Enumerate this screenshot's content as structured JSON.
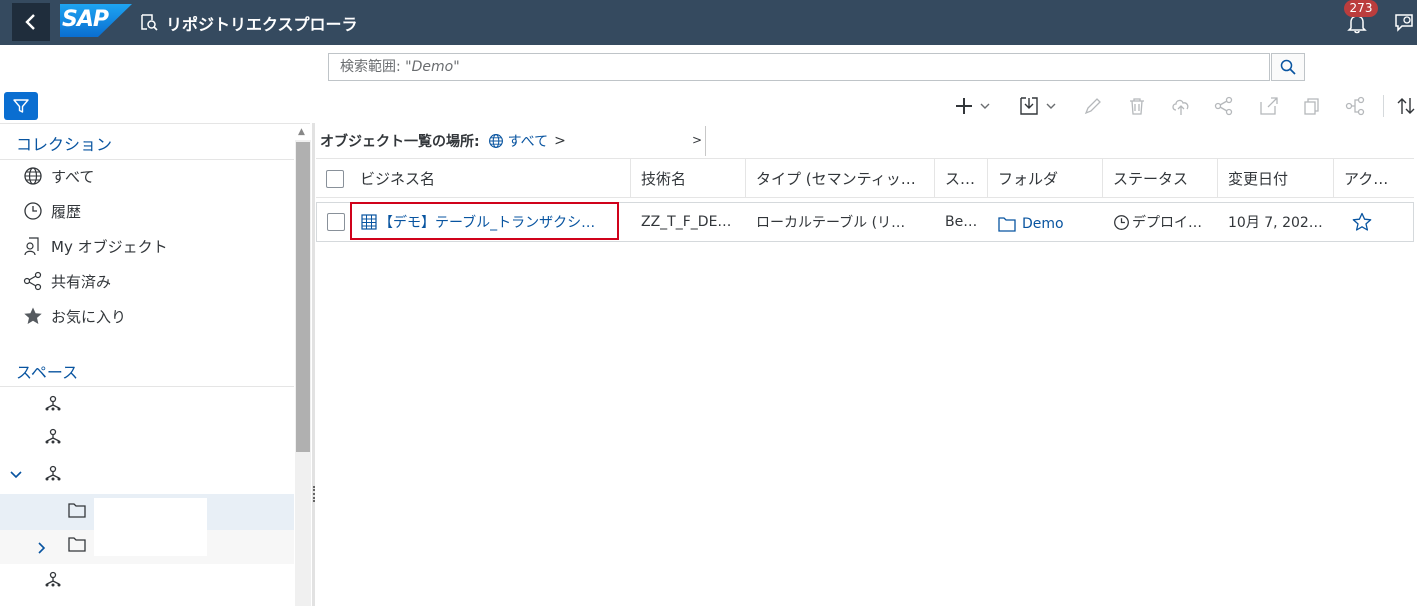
{
  "shell": {
    "logo_text": "SAP",
    "app_title": "リポジトリエクスプローラ",
    "notification_count": "273"
  },
  "search": {
    "label": "検索範囲:",
    "scope": "\"Demo\""
  },
  "left_panel": {
    "collections_title": "コレクション",
    "collections": [
      {
        "label": "すべて",
        "icon": "globe-icon"
      },
      {
        "label": "履歴",
        "icon": "clock-icon"
      },
      {
        "label": "My オブジェクト",
        "icon": "user-objects-icon"
      },
      {
        "label": "共有済み",
        "icon": "share-icon"
      },
      {
        "label": "お気に入り",
        "icon": "star-icon"
      }
    ],
    "spaces_title": "スペース"
  },
  "breadcrumb": {
    "label": "オブジェクト一覧の場所:",
    "root": "すべて",
    "separator": ">"
  },
  "table": {
    "columns": [
      "ビジネス名",
      "技術名",
      "タイプ (セマンティッ…",
      "ス…",
      "フォルダ",
      "ステータス",
      "変更日付",
      "アク…"
    ],
    "rows": [
      {
        "business_name": "【デモ】テーブル_トランザクシ…",
        "technical_name": "ZZ_T_F_DE…",
        "type": "ローカルテーブル (リ…",
        "space": "Be…",
        "folder": "Demo",
        "status": "デプロイ…",
        "changed_on": "10月 7, 202…"
      }
    ]
  },
  "colors": {
    "shell_bg": "#354a5f",
    "accent": "#0a6ed1",
    "link": "#0854a0",
    "badge": "#bb3d3d",
    "highlight": "#d0021b"
  }
}
